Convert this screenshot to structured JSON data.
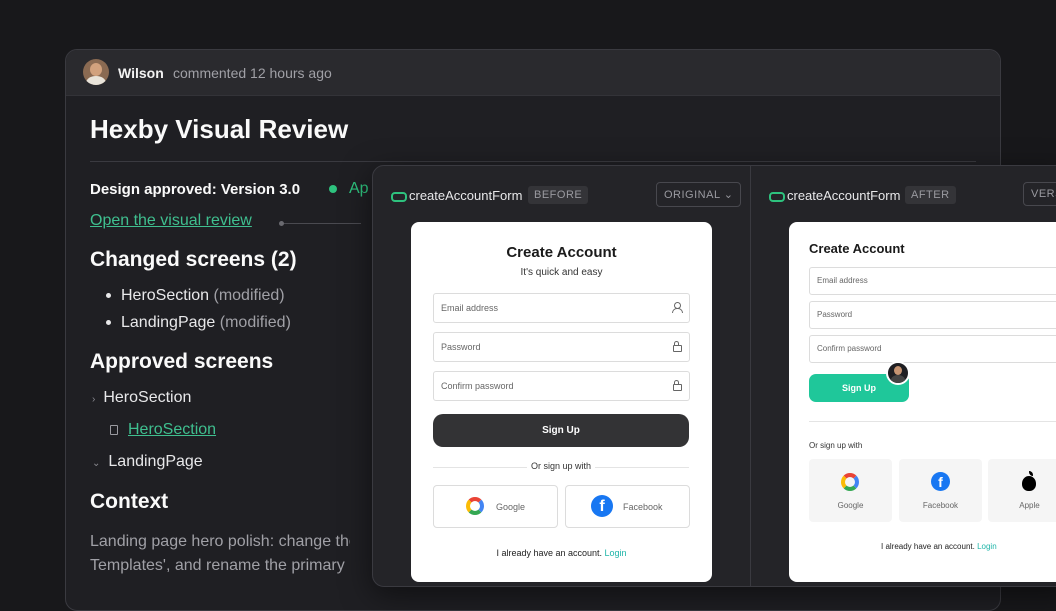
{
  "comment": {
    "author": "Wilson",
    "meta": "commented 12 hours ago",
    "title": "Hexby Visual Review",
    "approved_label": "Design approved: Version 3.0",
    "approved_status": "Ap",
    "review_link": "Open the visual review",
    "changed_heading": "Changed screens (2)",
    "changed": [
      {
        "name": "HeroSection",
        "status": "(modified)"
      },
      {
        "name": "LandingPage",
        "status": "(modified)"
      }
    ],
    "approved_heading": "Approved screens",
    "tree": {
      "group1": "HeroSection",
      "file1": "HeroSection",
      "group2": "LandingPage"
    },
    "context_heading": "Context",
    "context_line1": "Landing page hero polish: change the",
    "context_line2": "Templates', and rename the primary b"
  },
  "compare": {
    "before": {
      "component": "createAccountForm",
      "tag": "BEFORE",
      "select": "ORIGINAL",
      "form": {
        "title": "Create Account",
        "subtitle": "It's quick and easy",
        "email": "Email address",
        "password": "Password",
        "confirm": "Confirm password",
        "signup": "Sign Up",
        "or": "Or sign up with",
        "google": "Google",
        "facebook": "Facebook",
        "login_prefix": "I already have an account.",
        "login": "Login"
      }
    },
    "after": {
      "component": "createAccountForm",
      "tag": "AFTER",
      "select": "VERS",
      "form": {
        "title": "Create Account",
        "email": "Email address",
        "password": "Password",
        "confirm": "Confirm password",
        "signup": "Sign Up",
        "or": "Or sign up with",
        "google": "Google",
        "facebook": "Facebook",
        "apple": "Apple",
        "login_prefix": "I already have an account.",
        "login": "Login"
      }
    }
  },
  "colors": {
    "accent": "#2ec27e",
    "teal_button": "#1fc79a",
    "background": "#18181b"
  },
  "icons": [
    "avatar",
    "status-dot-icon",
    "link-icon",
    "chevron-right-icon",
    "chevron-down-icon",
    "file-icon",
    "user-icon",
    "lock-icon",
    "google-icon",
    "facebook-icon",
    "apple-icon"
  ]
}
